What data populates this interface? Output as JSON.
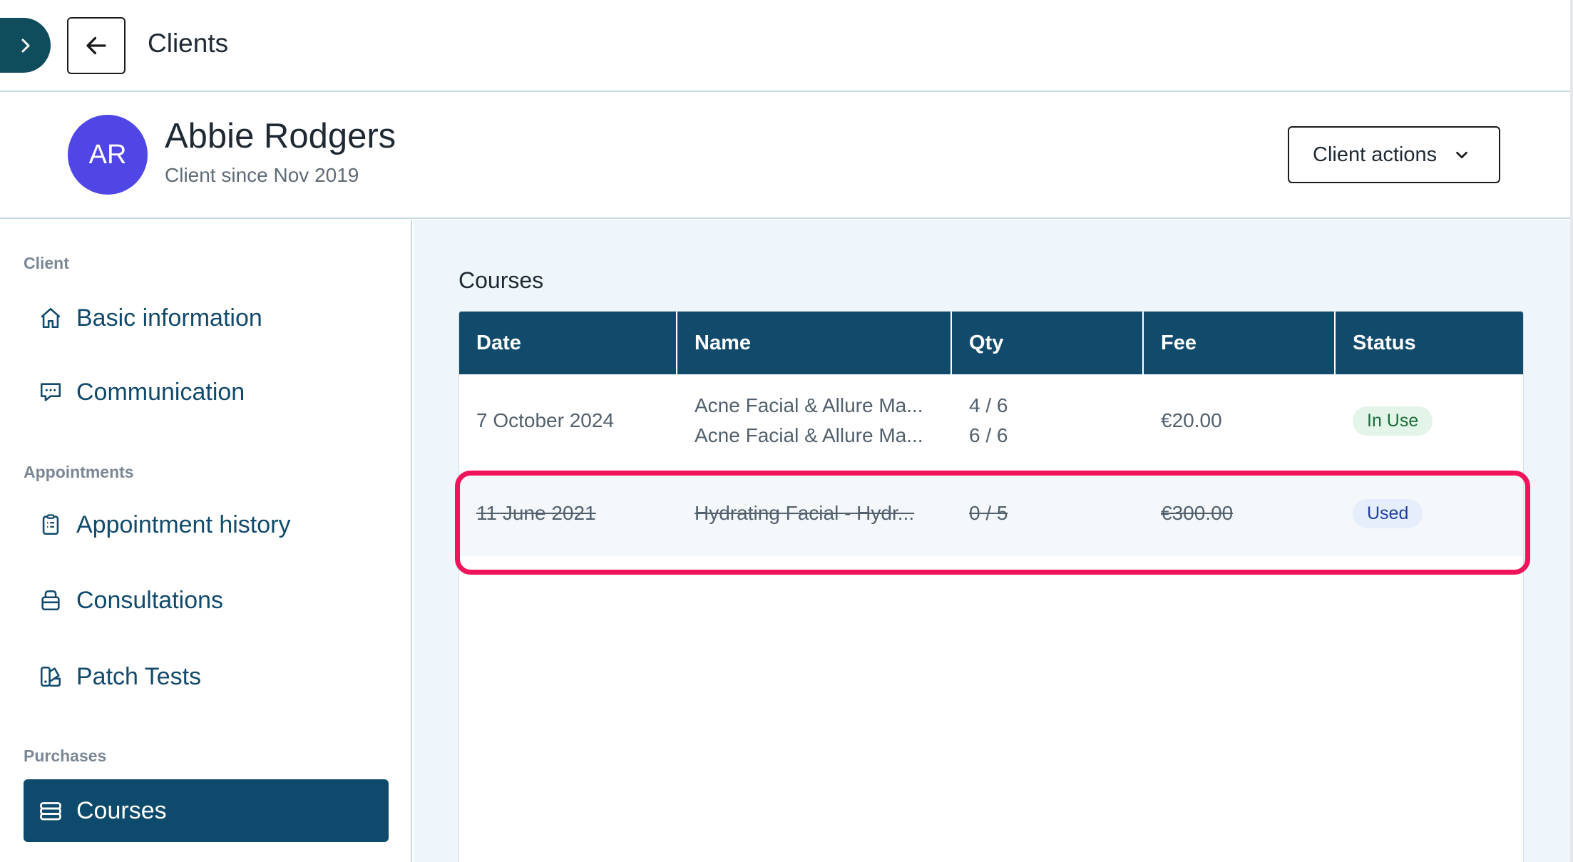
{
  "topbar": {
    "title": "Clients",
    "expand_icon": "chevron-right-icon",
    "back_icon": "arrow-left-icon",
    "accent": "#0f4c5c"
  },
  "client": {
    "initials": "AR",
    "name": "Abbie Rodgers",
    "since": "Client since Nov 2019",
    "actions_label": "Client actions",
    "avatar_color": "#4f46e5"
  },
  "sidebar": {
    "sections": [
      {
        "label": "Client",
        "items": [
          {
            "label": "Basic information",
            "icon": "home-icon"
          },
          {
            "label": "Communication",
            "icon": "chat-icon"
          }
        ]
      },
      {
        "label": "Appointments",
        "items": [
          {
            "label": "Appointment history",
            "icon": "clipboard-icon"
          },
          {
            "label": "Consultations",
            "icon": "bag-icon"
          },
          {
            "label": "Patch Tests",
            "icon": "swatch-icon"
          }
        ]
      },
      {
        "label": "Purchases",
        "items": [
          {
            "label": "Courses",
            "icon": "courses-icon",
            "active": true
          }
        ]
      }
    ]
  },
  "courses": {
    "title": "Courses",
    "columns": [
      "Date",
      "Name",
      "Qty",
      "Fee",
      "Status"
    ],
    "rows": [
      {
        "date": "7 October 2024",
        "names": [
          "Acne Facial & Allure Ma...",
          "Acne Facial & Allure Ma..."
        ],
        "qtys": [
          "4 / 6",
          "6 / 6"
        ],
        "fee": "€20.00",
        "status": "In Use"
      },
      {
        "date": "11 June 2021",
        "names": [
          "Hydrating Facial - Hydr..."
        ],
        "qtys": [
          "0 / 5"
        ],
        "fee": "€300.00",
        "status": "Used"
      }
    ]
  },
  "colors": {
    "header_bg": "#124a6b",
    "highlight": "#f0145a",
    "main_bg": "#eef6fc"
  }
}
